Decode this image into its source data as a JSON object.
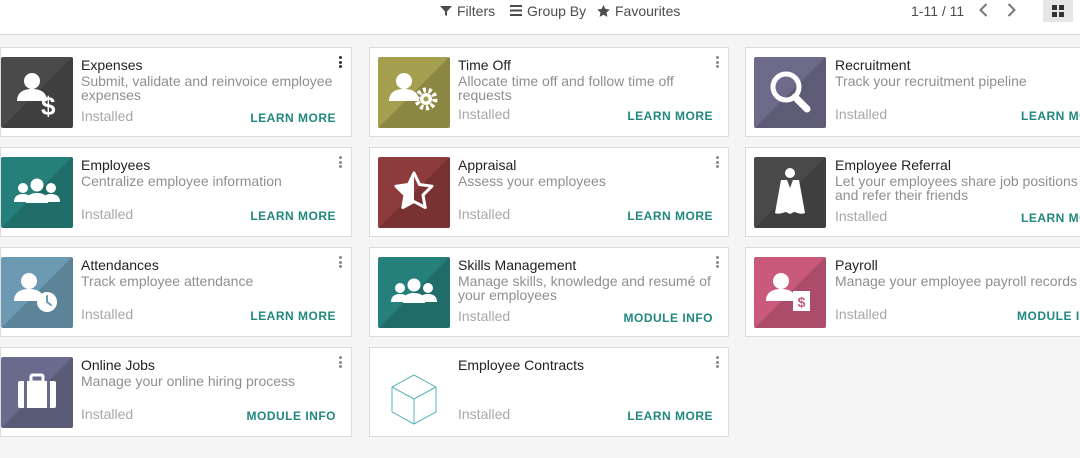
{
  "toolbar": {
    "filters_label": "Filters",
    "groupby_label": "Group By",
    "favourites_label": "Favourites",
    "pager_text": "1-11 / 11"
  },
  "colors": {
    "accent": "#21887f",
    "expenses": "#4a4a4a",
    "timeoff": "#a39f4e",
    "recruitment": "#6e6b8a",
    "employees": "#25807b",
    "appraisal": "#8e3b3b",
    "referral": "#4a4a4a",
    "attendances": "#6c9ab3",
    "skills": "#25807b",
    "payroll": "#c95a7c",
    "onlinejobs": "#6a6b8c"
  },
  "apps": [
    {
      "name": "Expenses",
      "summary": "Submit, validate and reinvoice employee expenses",
      "status": "Installed",
      "action": "LEARN MORE",
      "icon": "expense-user-dollar-icon"
    },
    {
      "name": "Time Off",
      "summary": "Allocate time off and follow time off requests",
      "status": "Installed",
      "action": "LEARN MORE",
      "icon": "user-gear-icon"
    },
    {
      "name": "Recruitment",
      "summary": "Track your recruitment pipeline",
      "status": "Installed",
      "action": "LEARN MORE",
      "icon": "magnifier-icon"
    },
    {
      "name": "Employees",
      "summary": "Centralize employee information",
      "status": "Installed",
      "action": "LEARN MORE",
      "icon": "users-group-icon"
    },
    {
      "name": "Appraisal",
      "summary": "Assess your employees",
      "status": "Installed",
      "action": "LEARN MORE",
      "icon": "half-star-icon"
    },
    {
      "name": "Employee Referral",
      "summary": "Let your employees share job positions and refer their friends",
      "status": "Installed",
      "action": "LEARN MORE",
      "icon": "superhero-cape-icon"
    },
    {
      "name": "Attendances",
      "summary": "Track employee attendance",
      "status": "Installed",
      "action": "LEARN MORE",
      "icon": "user-clock-icon"
    },
    {
      "name": "Skills Management",
      "summary": "Manage skills, knowledge and resumé of your employees",
      "status": "Installed",
      "action": "MODULE INFO",
      "icon": "users-group-icon"
    },
    {
      "name": "Payroll",
      "summary": "Manage your employee payroll records",
      "status": "Installed",
      "action": "MODULE INFO",
      "icon": "user-payslip-icon"
    },
    {
      "name": "Online Jobs",
      "summary": "Manage your online hiring process",
      "status": "Installed",
      "action": "MODULE INFO",
      "icon": "briefcase-icon"
    },
    {
      "name": "Employee Contracts",
      "summary": "",
      "status": "Installed",
      "action": "LEARN MORE",
      "icon": "cube-outline-icon"
    }
  ]
}
